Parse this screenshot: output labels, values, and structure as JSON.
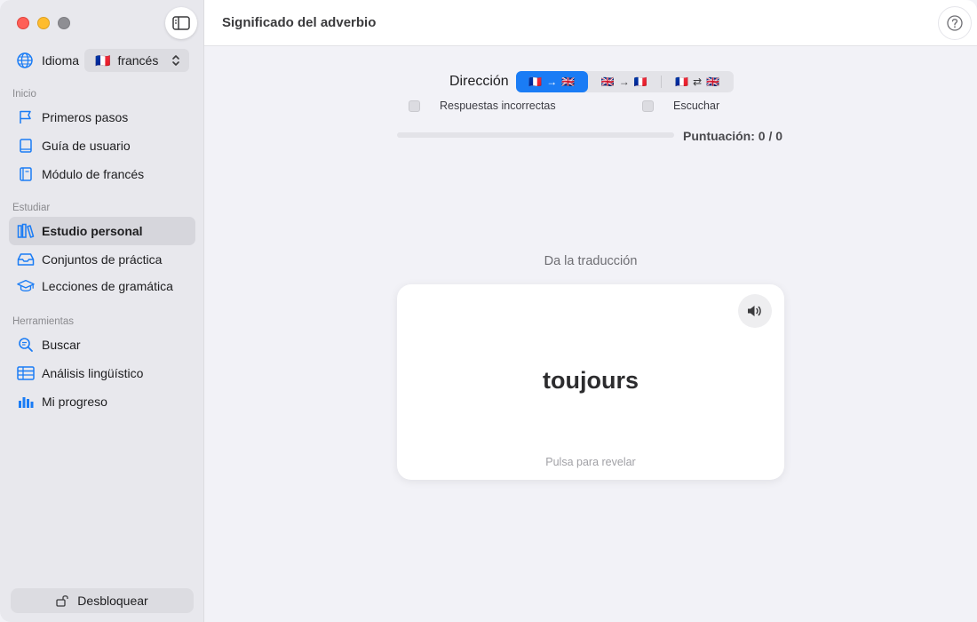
{
  "sidebar": {
    "language_label": "Idioma",
    "language_value": "francés",
    "language_flag": "🇫🇷",
    "sections": {
      "inicio": "Inicio",
      "estudiar": "Estudiar",
      "herramientas": "Herramientas"
    },
    "items": {
      "primeros_pasos": "Primeros pasos",
      "guia_usuario": "Guía de usuario",
      "modulo_frances": "Módulo de francés",
      "estudio_personal": "Estudio personal",
      "conjuntos": "Conjuntos de práctica",
      "lecciones": "Lecciones de gramática",
      "buscar": "Buscar",
      "analisis": "Análisis lingüístico",
      "progreso": "Mi progreso"
    },
    "active_item": "estudio_personal",
    "unlock_label": "Desbloquear"
  },
  "toolbar": {
    "title": "Significado del adverbio"
  },
  "quiz": {
    "direction_label": "Dirección",
    "direction_options": [
      {
        "from": "🇫🇷",
        "arrow": "→",
        "to": "🇬🇧"
      },
      {
        "from": "🇬🇧",
        "arrow": "→",
        "to": "🇫🇷"
      },
      {
        "from": "🇫🇷",
        "arrow": "⇄",
        "to": "🇬🇧"
      }
    ],
    "direction_selected": 0,
    "checkbox_wrong": "Respuestas incorrectas",
    "checkbox_listen": "Escuchar",
    "checkbox_wrong_checked": false,
    "checkbox_listen_checked": false,
    "progress_fraction": 0,
    "score_text": "Puntuación: 0 / 0",
    "prompt": "Da la traducción",
    "word": "toujours",
    "hint": "Pulsa para revelar"
  },
  "colors": {
    "accent": "#1a7cf5",
    "icon": "#1a7cf5",
    "close": "#ff5f57",
    "minimize": "#febc2e",
    "maximize": "#8e8e93"
  },
  "icons": {
    "language": "globe-icon",
    "primeros_pasos": "flag-icon",
    "guia_usuario": "book-icon",
    "modulo_frances": "book-closed-icon",
    "estudio_personal": "books-icon",
    "conjuntos": "tray-icon",
    "lecciones": "graduation-cap-icon",
    "buscar": "magnifier-icon",
    "analisis": "table-icon",
    "progreso": "bar-chart-icon",
    "unlock": "lock-open-icon",
    "help": "question-circle-icon",
    "speaker": "speaker-icon",
    "sidebar_toggle": "sidebar-icon"
  }
}
